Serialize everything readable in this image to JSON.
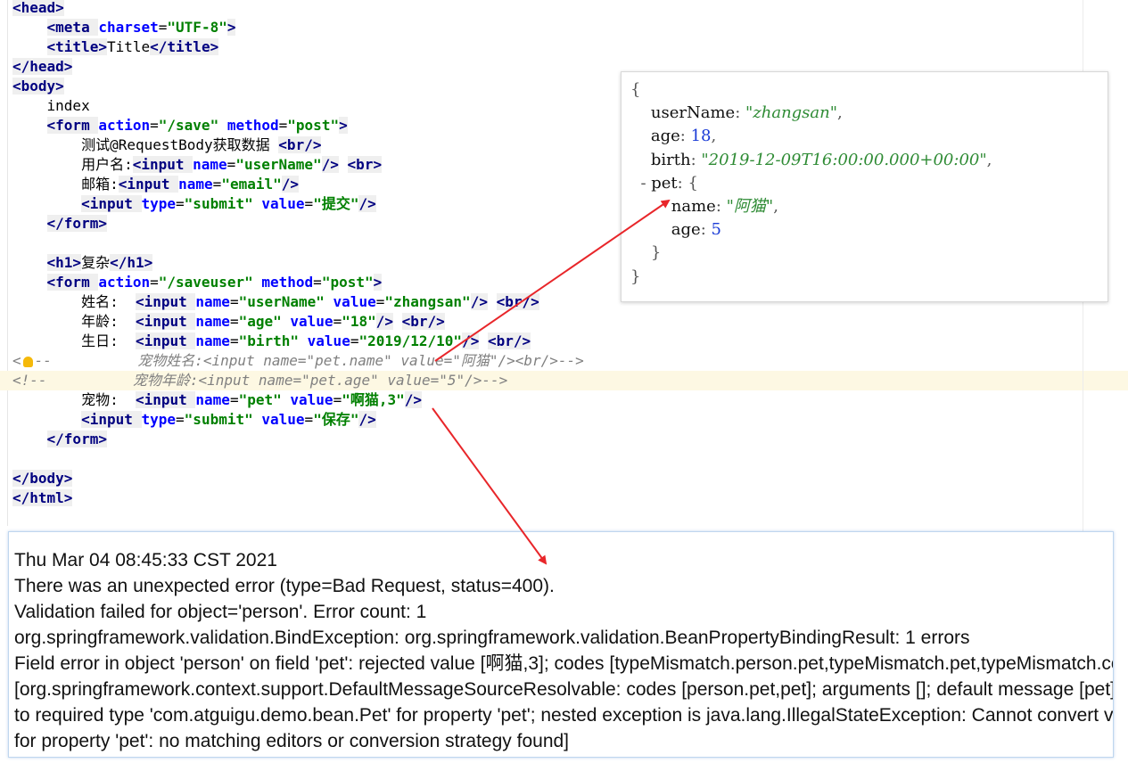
{
  "editor": {
    "lines": [
      [
        {
          "t": "tag",
          "v": "<head>"
        }
      ],
      [
        {
          "t": "txt",
          "v": "    "
        },
        {
          "t": "tag",
          "v": "<meta "
        },
        {
          "t": "attr",
          "v": "charset"
        },
        {
          "t": "txt",
          "v": "="
        },
        {
          "t": "val",
          "v": "\"UTF-8\""
        },
        {
          "t": "tag",
          "v": ">"
        }
      ],
      [
        {
          "t": "txt",
          "v": "    "
        },
        {
          "t": "tag",
          "v": "<title>"
        },
        {
          "t": "txt",
          "v": "Title"
        },
        {
          "t": "tag",
          "v": "</title>"
        }
      ],
      [
        {
          "t": "tag",
          "v": "</head>"
        }
      ],
      [
        {
          "t": "tag",
          "v": "<body>"
        }
      ],
      [
        {
          "t": "txt",
          "v": "    index"
        }
      ],
      [
        {
          "t": "txt",
          "v": "    "
        },
        {
          "t": "tag",
          "v": "<form "
        },
        {
          "t": "attr",
          "v": "action"
        },
        {
          "t": "txt",
          "v": "="
        },
        {
          "t": "val",
          "v": "\"/save\""
        },
        {
          "t": "txt",
          "v": " "
        },
        {
          "t": "attr",
          "v": "method"
        },
        {
          "t": "txt",
          "v": "="
        },
        {
          "t": "val",
          "v": "\"post\""
        },
        {
          "t": "tag",
          "v": ">"
        }
      ],
      [
        {
          "t": "txt",
          "v": "        测试@RequestBody获取数据 "
        },
        {
          "t": "tag",
          "v": "<br/>"
        }
      ],
      [
        {
          "t": "txt",
          "v": "        用户名:"
        },
        {
          "t": "tag",
          "v": "<input "
        },
        {
          "t": "attr",
          "v": "name"
        },
        {
          "t": "txt",
          "v": "="
        },
        {
          "t": "val",
          "v": "\"userName\""
        },
        {
          "t": "tag",
          "v": "/>"
        },
        {
          "t": "txt",
          "v": " "
        },
        {
          "t": "tag",
          "v": "<br>"
        }
      ],
      [
        {
          "t": "txt",
          "v": "        邮箱:"
        },
        {
          "t": "tag",
          "v": "<input "
        },
        {
          "t": "attr",
          "v": "name"
        },
        {
          "t": "txt",
          "v": "="
        },
        {
          "t": "val",
          "v": "\"email\""
        },
        {
          "t": "tag",
          "v": "/>"
        }
      ],
      [
        {
          "t": "txt",
          "v": "        "
        },
        {
          "t": "tag",
          "v": "<input "
        },
        {
          "t": "attr",
          "v": "type"
        },
        {
          "t": "txt",
          "v": "="
        },
        {
          "t": "val",
          "v": "\"submit\""
        },
        {
          "t": "txt",
          "v": " "
        },
        {
          "t": "attr",
          "v": "value"
        },
        {
          "t": "txt",
          "v": "="
        },
        {
          "t": "val",
          "v": "\"提交\""
        },
        {
          "t": "tag",
          "v": "/>"
        }
      ],
      [
        {
          "t": "txt",
          "v": "    "
        },
        {
          "t": "tag",
          "v": "</form>"
        }
      ],
      [],
      [
        {
          "t": "txt",
          "v": "    "
        },
        {
          "t": "tag",
          "v": "<h1>"
        },
        {
          "t": "txt",
          "v": "复杂"
        },
        {
          "t": "tag",
          "v": "</h1>"
        }
      ],
      [
        {
          "t": "txt",
          "v": "    "
        },
        {
          "t": "tag",
          "v": "<form "
        },
        {
          "t": "attr",
          "v": "action"
        },
        {
          "t": "txt",
          "v": "="
        },
        {
          "t": "val",
          "v": "\"/saveuser\""
        },
        {
          "t": "txt",
          "v": " "
        },
        {
          "t": "attr",
          "v": "method"
        },
        {
          "t": "txt",
          "v": "="
        },
        {
          "t": "val",
          "v": "\"post\""
        },
        {
          "t": "tag",
          "v": ">"
        }
      ],
      [
        {
          "t": "txt",
          "v": "        姓名:  "
        },
        {
          "t": "tag",
          "v": "<input "
        },
        {
          "t": "attr",
          "v": "name"
        },
        {
          "t": "txt",
          "v": "="
        },
        {
          "t": "val",
          "v": "\"userName\""
        },
        {
          "t": "txt",
          "v": " "
        },
        {
          "t": "attr",
          "v": "value"
        },
        {
          "t": "txt",
          "v": "="
        },
        {
          "t": "val",
          "v": "\"zhangsan\""
        },
        {
          "t": "tag",
          "v": "/>"
        },
        {
          "t": "txt",
          "v": " "
        },
        {
          "t": "tag",
          "v": "<br/>"
        }
      ],
      [
        {
          "t": "txt",
          "v": "        年龄:  "
        },
        {
          "t": "tag",
          "v": "<input "
        },
        {
          "t": "attr",
          "v": "name"
        },
        {
          "t": "txt",
          "v": "="
        },
        {
          "t": "val",
          "v": "\"age\""
        },
        {
          "t": "txt",
          "v": " "
        },
        {
          "t": "attr",
          "v": "value"
        },
        {
          "t": "txt",
          "v": "="
        },
        {
          "t": "val",
          "v": "\"18\""
        },
        {
          "t": "tag",
          "v": "/>"
        },
        {
          "t": "txt",
          "v": " "
        },
        {
          "t": "tag",
          "v": "<br/>"
        }
      ],
      [
        {
          "t": "txt",
          "v": "        生日:  "
        },
        {
          "t": "tag",
          "v": "<input "
        },
        {
          "t": "attr",
          "v": "name"
        },
        {
          "t": "txt",
          "v": "="
        },
        {
          "t": "val",
          "v": "\"birth\""
        },
        {
          "t": "txt",
          "v": " "
        },
        {
          "t": "attr",
          "v": "value"
        },
        {
          "t": "txt",
          "v": "="
        },
        {
          "t": "val",
          "v": "\"2019/12/10\""
        },
        {
          "t": "tag",
          "v": "/>"
        },
        {
          "t": "txt",
          "v": " "
        },
        {
          "t": "tag",
          "v": "<br/>"
        }
      ],
      [
        {
          "t": "cmt",
          "v": "<"
        },
        {
          "t": "bulb",
          "v": ""
        },
        {
          "t": "cmt",
          "v": "--          宠物姓名:<input name=\"pet.name\" value=\"阿猫\"/><br/>-->"
        }
      ],
      [
        {
          "t": "cmt",
          "v": "<!--          宠物年龄:<input name=\"pet.age\" value=\"5\"/>-->"
        }
      ],
      [
        {
          "t": "txt",
          "v": "        宠物:  "
        },
        {
          "t": "tag",
          "v": "<input "
        },
        {
          "t": "attr",
          "v": "name"
        },
        {
          "t": "txt",
          "v": "="
        },
        {
          "t": "val",
          "v": "\"pet\""
        },
        {
          "t": "txt",
          "v": " "
        },
        {
          "t": "attr",
          "v": "value"
        },
        {
          "t": "txt",
          "v": "="
        },
        {
          "t": "val",
          "v": "\"啊猫,3\""
        },
        {
          "t": "tag",
          "v": "/>"
        }
      ],
      [
        {
          "t": "txt",
          "v": "        "
        },
        {
          "t": "tag",
          "v": "<input "
        },
        {
          "t": "attr",
          "v": "type"
        },
        {
          "t": "txt",
          "v": "="
        },
        {
          "t": "val",
          "v": "\"submit\""
        },
        {
          "t": "txt",
          "v": " "
        },
        {
          "t": "attr",
          "v": "value"
        },
        {
          "t": "txt",
          "v": "="
        },
        {
          "t": "val",
          "v": "\"保存\""
        },
        {
          "t": "tag",
          "v": "/>"
        }
      ],
      [
        {
          "t": "txt",
          "v": "    "
        },
        {
          "t": "tag",
          "v": "</form>"
        }
      ],
      [],
      [
        {
          "t": "tag",
          "v": "</body>"
        }
      ],
      [
        {
          "t": "tag",
          "v": "</html>"
        }
      ]
    ],
    "highlighted_line": 19
  },
  "json_popup": {
    "lines": [
      [
        {
          "t": "p",
          "v": "{"
        }
      ],
      [
        {
          "t": "p",
          "v": "    "
        },
        {
          "t": "k",
          "v": "userName"
        },
        {
          "t": "p",
          "v": ": "
        },
        {
          "t": "s",
          "v": "\"zhangsan\""
        },
        {
          "t": "p",
          "v": ","
        }
      ],
      [
        {
          "t": "p",
          "v": "    "
        },
        {
          "t": "k",
          "v": "age"
        },
        {
          "t": "p",
          "v": ": "
        },
        {
          "t": "n",
          "v": "18"
        },
        {
          "t": "p",
          "v": ","
        }
      ],
      [
        {
          "t": "p",
          "v": "    "
        },
        {
          "t": "k",
          "v": "birth"
        },
        {
          "t": "p",
          "v": ": "
        },
        {
          "t": "s",
          "v": "\"2019-12-09T16:00:00.000+00:00\""
        },
        {
          "t": "p",
          "v": ","
        }
      ],
      [
        {
          "t": "p",
          "v": "  - "
        },
        {
          "t": "k",
          "v": "pet"
        },
        {
          "t": "p",
          "v": ": {"
        }
      ],
      [
        {
          "t": "p",
          "v": "        "
        },
        {
          "t": "k",
          "v": "name"
        },
        {
          "t": "p",
          "v": ": "
        },
        {
          "t": "s",
          "v": "\"阿猫\""
        },
        {
          "t": "p",
          "v": ","
        }
      ],
      [
        {
          "t": "p",
          "v": "        "
        },
        {
          "t": "k",
          "v": "age"
        },
        {
          "t": "p",
          "v": ": "
        },
        {
          "t": "n",
          "v": "5"
        }
      ],
      [
        {
          "t": "p",
          "v": "    }"
        }
      ],
      [
        {
          "t": "p",
          "v": "}"
        }
      ]
    ]
  },
  "error_page": {
    "lines": [
      "Thu Mar 04 08:45:33 CST 2021",
      "There was an unexpected error (type=Bad Request, status=400).",
      "Validation failed for object='person'. Error count: 1",
      "org.springframework.validation.BindException: org.springframework.validation.BeanPropertyBindingResult: 1 errors",
      "Field error in object 'person' on field 'pet': rejected value [啊猫,3]; codes [typeMismatch.person.pet,typeMismatch.pet,typeMismatch.com.atguigu.demo.bean.Pet,typeMismatch];",
      "[org.springframework.context.support.DefaultMessageSourceResolvable: codes [person.pet,pet]; arguments []; default message [pet]]; default message [Failed to convert property value",
      "to required type 'com.atguigu.demo.bean.Pet' for property 'pet'; nested exception is java.lang.IllegalStateException: Cannot convert value of type 'java.lang.String' to required type",
      "for property 'pet': no matching editors or conversion strategy found]"
    ]
  },
  "colors": {
    "arrow": "#e8262a",
    "tag": "#000080",
    "attr": "#0000ff",
    "value": "#008000",
    "comment": "#808080"
  }
}
